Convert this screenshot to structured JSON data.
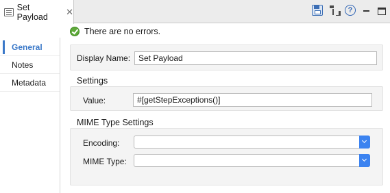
{
  "tab": {
    "title": "Set Payload",
    "close": "✕"
  },
  "toolbar": {
    "help": "?"
  },
  "nav": {
    "items": [
      "General",
      "Notes",
      "Metadata"
    ]
  },
  "status": {
    "message": "There are no errors."
  },
  "general": {
    "display_name_label": "Display Name:",
    "display_name_value": "Set Payload"
  },
  "settings": {
    "title": "Settings",
    "value_label": "Value:",
    "value_value": "#[getStepExceptions()]"
  },
  "mime": {
    "title": "MIME Type Settings",
    "encoding_label": "Encoding:",
    "encoding_value": "",
    "mime_type_label": "MIME Type:",
    "mime_type_value": ""
  },
  "colors": {
    "accent": "#3a78c8",
    "ok": "#5faa3a",
    "dropdown": "#3c83f0"
  }
}
